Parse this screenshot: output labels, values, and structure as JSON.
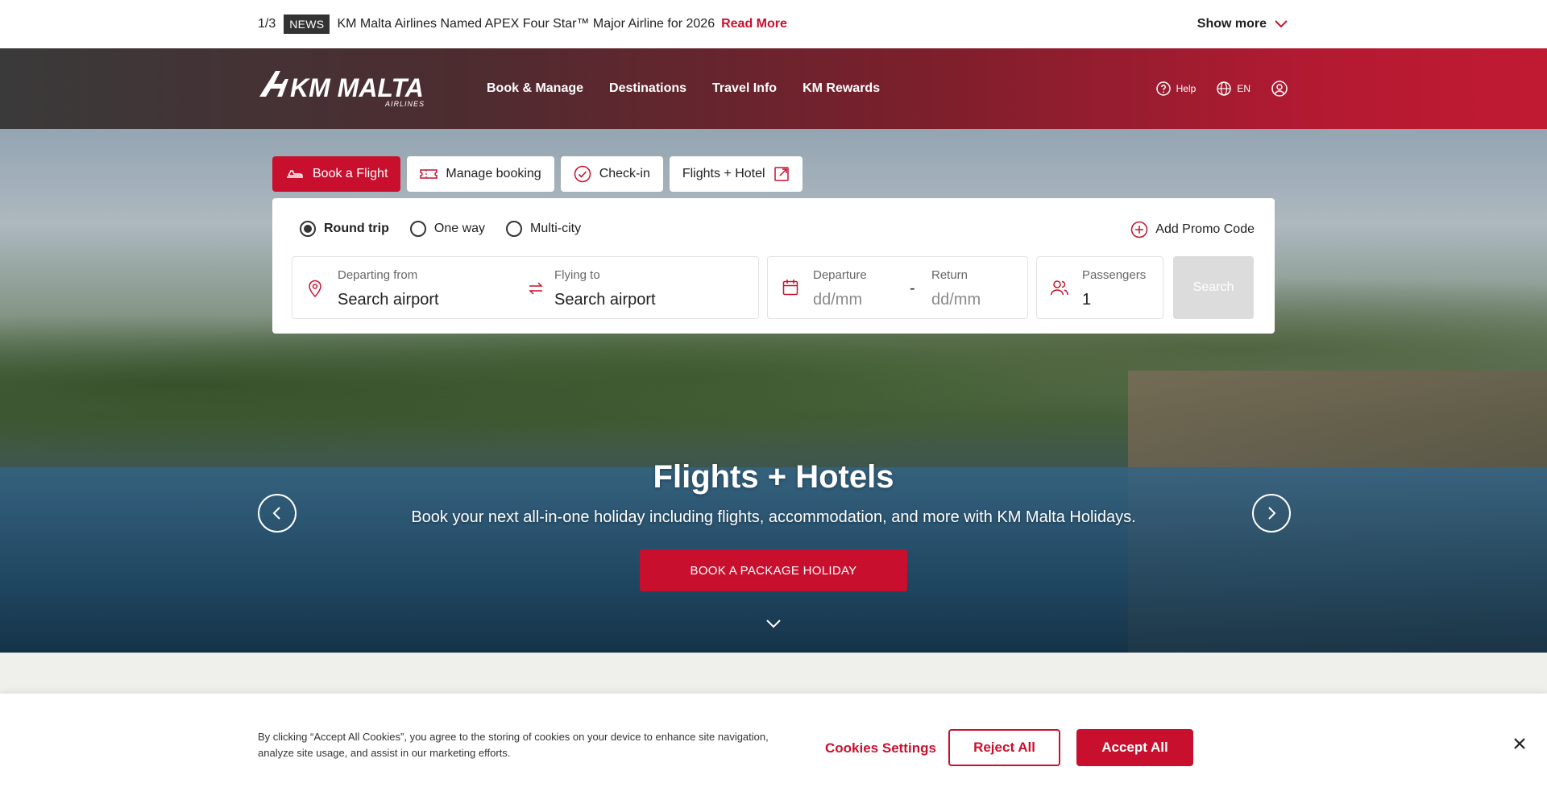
{
  "news": {
    "counter": "1/3",
    "badge": "NEWS",
    "headline": "KM Malta Airlines Named APEX Four Star™ Major Airline for 2026",
    "link": "Read More",
    "show_more": "Show more"
  },
  "header": {
    "logo_text": "KM MALTA",
    "logo_sub": "AIRLINES",
    "nav": [
      "Book & Manage",
      "Destinations",
      "Travel Info",
      "KM Rewards"
    ],
    "help": "Help",
    "language": "EN"
  },
  "booking": {
    "tabs": [
      "Book a Flight",
      "Manage booking",
      "Check-in",
      "Flights + Hotel"
    ],
    "trip_types": [
      "Round trip",
      "One way",
      "Multi-city"
    ],
    "selected_trip": "Round trip",
    "promo": "Add Promo Code",
    "from_label": "Departing from",
    "from_value": "Search airport",
    "to_label": "Flying to",
    "to_value": "Search airport",
    "departure_label": "Departure",
    "departure_placeholder": "dd/mm",
    "date_separator": "-",
    "return_label": "Return",
    "return_placeholder": "dd/mm",
    "passengers_label": "Passengers",
    "passengers_value": "1",
    "search": "Search"
  },
  "hero": {
    "title": "Flights + Hotels",
    "subtitle": "Book your next all-in-one holiday including flights, accommodation, and more with KM Malta Holidays.",
    "cta": "BOOK A PACKAGE HOLIDAY"
  },
  "cookie": {
    "text": "By clicking “Accept All Cookies”, you agree to the storing of cookies on your device to enhance site navigation, analyze site usage, and assist in our marketing efforts.",
    "settings": "Cookies Settings",
    "reject": "Reject All",
    "accept": "Accept All"
  },
  "colors": {
    "brand": "#c8102e",
    "header_dark": "#3a3a3a"
  },
  "icons": [
    "chevron-down-icon",
    "help-icon",
    "globe-icon",
    "user-icon",
    "plane-icon",
    "ticket-icon",
    "check-circle-icon",
    "external-link-icon",
    "plus-circle-icon",
    "location-pin-icon",
    "swap-icon",
    "calendar-icon",
    "passengers-icon",
    "chevron-left-icon",
    "chevron-right-icon",
    "close-icon"
  ]
}
